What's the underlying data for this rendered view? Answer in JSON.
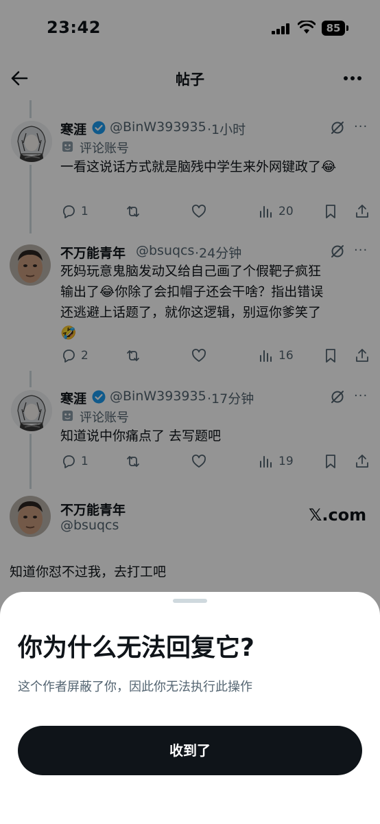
{
  "status_bar": {
    "time": "23:42",
    "battery": "85"
  },
  "header": {
    "title": "帖子"
  },
  "tweets": [
    {
      "name": "寒涯",
      "handle": "@BinW393935",
      "time": "·1小时",
      "sub_label": "评论账号",
      "text": "一看这说话方式就是脑残中学生来外网键政了😂",
      "replies": "1",
      "views": "20"
    },
    {
      "name": "不万能青年",
      "handle": "@bsuqcs",
      "time": "·24分钟",
      "text_lines": [
        "死妈玩意鬼脑发动又给自己画了个假靶子疯狂",
        "输出了😂你除了会扣帽子还会干啥？指出错误",
        "还逃避上话题了，就你这逻辑，别逗你爹笑了",
        "🤣"
      ],
      "replies": "2",
      "views": "16"
    },
    {
      "name": "寒涯",
      "handle": "@BinW393935",
      "time": "·17分钟",
      "sub_label": "评论账号",
      "text": "知道说中你痛点了  去写题吧",
      "replies": "1",
      "views": "19"
    }
  ],
  "main_post": {
    "name": "不万能青年",
    "handle": "@bsuqcs",
    "source": "𝕏.com",
    "text": "知道你怼不过我，去打工吧"
  },
  "sheet": {
    "title": "你为什么无法回复它?",
    "description": "这个作者屏蔽了你，因此你无法执行此操作",
    "button": "收到了"
  },
  "colors": {
    "primary_text": "#0f1419",
    "secondary_text": "#536471",
    "verified": "#1d9bf0",
    "button_bg": "#0f1419"
  }
}
